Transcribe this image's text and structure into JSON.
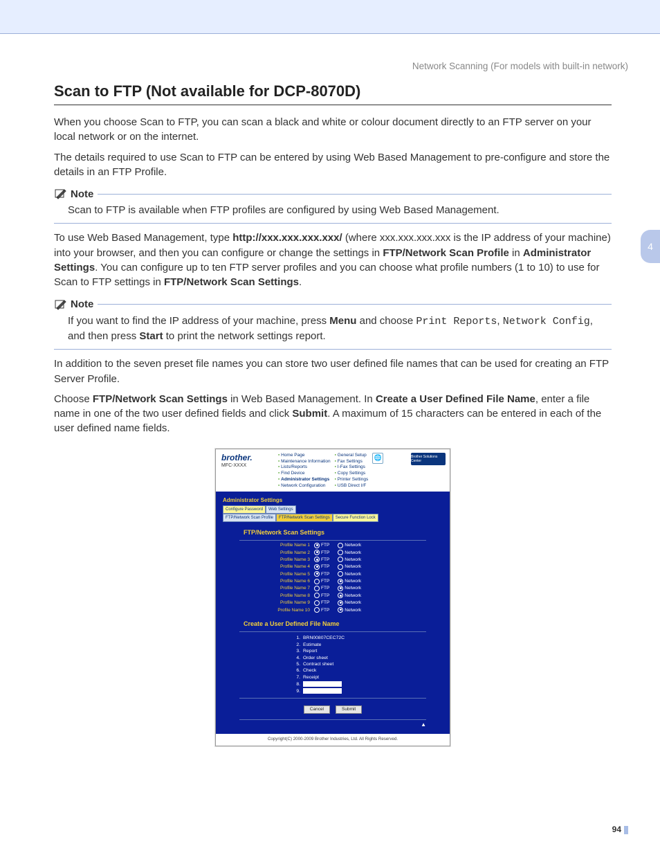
{
  "header": {
    "right": "Network Scanning (For models with built-in network)"
  },
  "chapter_tab": "4",
  "title": "Scan to FTP (Not available for DCP-8070D)",
  "p1": "When you choose Scan to FTP, you can scan a black and white or colour document directly to an FTP server on your local network or on the internet.",
  "p2": "The details required to use Scan to FTP can be entered by using Web Based Management to pre-configure and store the details in an FTP Profile.",
  "note_label": "Note",
  "note1": "Scan to FTP is available when FTP profiles are configured by using Web Based Management.",
  "p3a": "To use Web Based Management, type ",
  "p3b": "http://xxx.xxx.xxx.xxx/",
  "p3c": " (where xxx.xxx.xxx.xxx is the IP address of your machine) into your browser, and then you can configure or change the settings in ",
  "p3d": "FTP/Network Scan Profile",
  "p3e": " in ",
  "p3f": "Administrator Settings",
  "p3g": ". You can configure up to ten FTP server profiles and you can choose what profile numbers (1 to 10) to use for Scan to FTP settings in ",
  "p3h": "FTP/Network Scan Settings",
  "p3i": ".",
  "note2a": "If you want to find the IP address of your machine, press ",
  "note2b": "Menu",
  "note2c": " and choose ",
  "note2d": "Print Reports",
  "note2e": ", ",
  "note2f": "Network Config",
  "note2g": ", and then press ",
  "note2h": "Start",
  "note2i": " to print the network settings report.",
  "p4": "In addition to the seven preset file names you can store two user defined file names that can be used for creating an FTP Server Profile.",
  "p5a": "Choose ",
  "p5b": "FTP/Network Scan Settings",
  "p5c": " in Web Based Management. In ",
  "p5d": "Create a User Defined File Name",
  "p5e": ", enter a file name in one of the two user defined fields and click ",
  "p5f": "Submit",
  "p5g": ". A maximum of 15 characters can be entered in each of the user defined name fields.",
  "page_number": "94",
  "shot": {
    "brand": "brother.",
    "model": "MFC-XXXX",
    "solutions_center": "Brother Solutions Center",
    "nav_left": [
      "Home Page",
      "Maintenance Information",
      "Lists/Reports",
      "Find Device",
      "Administrator Settings",
      "Network Configuration"
    ],
    "nav_right": [
      "General Setup",
      "Fax Settings",
      "I-Fax Settings",
      "Copy Settings",
      "Printer Settings",
      "USB Direct I/F"
    ],
    "admin_title": "Administrator Settings",
    "tabs_row1": [
      "Configure Password",
      "Web Settings"
    ],
    "tabs_row2": [
      "FTP/Network Scan Profile",
      "FTP/Network Scan Settings",
      "Secure Function Lock"
    ],
    "section1": "FTP/Network Scan Settings",
    "profiles": [
      {
        "label": "Profile Name 1",
        "ftp": true,
        "net": false
      },
      {
        "label": "Profile Name 2",
        "ftp": true,
        "net": false
      },
      {
        "label": "Profile Name 3",
        "ftp": true,
        "net": false
      },
      {
        "label": "Profile Name 4",
        "ftp": true,
        "net": false
      },
      {
        "label": "Profile Name 5",
        "ftp": true,
        "net": false
      },
      {
        "label": "Profile Name 6",
        "ftp": false,
        "net": true
      },
      {
        "label": "Profile Name 7",
        "ftp": false,
        "net": true
      },
      {
        "label": "Profile Name 8",
        "ftp": false,
        "net": true
      },
      {
        "label": "Profile Name 9",
        "ftp": false,
        "net": true
      },
      {
        "label": "Profile Name 10",
        "ftp": false,
        "net": true
      }
    ],
    "opt_ftp": "FTP",
    "opt_net": "Network",
    "section2": "Create a User Defined File Name",
    "filenames": [
      "BRN00807CEC72C",
      "Estimate",
      "Report",
      "Order sheet",
      "Contract sheet",
      "Check",
      "Receipt"
    ],
    "input8": "8.",
    "input9": "9.",
    "btn_cancel": "Cancel",
    "btn_submit": "Submit",
    "copyright": "Copyright(C) 2000-2009 Brother Industries, Ltd. All Rights Reserved."
  }
}
